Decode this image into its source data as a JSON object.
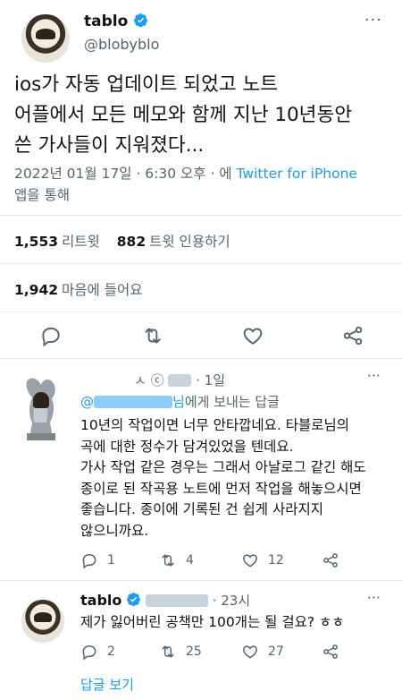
{
  "main": {
    "name": "tablo",
    "handle": "@blobyblo",
    "more": "···",
    "text_lines": [
      "ios가 자동 업데이트 되었고 노트",
      "어플에서 모든 메모와 함께 지난 10년동안",
      "쓴 가사들이 지워졌다..."
    ],
    "meta_time": "2022년 01월 17일 · 6:30 오후 · 에 ",
    "meta_source": "Twitter for iPhone",
    "meta_suffix": "앱을 통해",
    "retweets_count": "1,553",
    "retweets_label": "리트윗",
    "quotes_count": "882",
    "quotes_label": "트윗 인용하기",
    "likes_count": "1,942",
    "likes_label": "마음에 들어요"
  },
  "reply1": {
    "header_mark": "ㅅ ⓒ",
    "time": "· 1일",
    "more": "···",
    "to_prefix": "@",
    "to_mention_end": "님",
    "to_suffix": "에게 보내는 답글",
    "text_lines": [
      "10년의 작업이면 너무 안타깝네요. 타블로님의",
      "곡에 대한 정수가 담겨있었을 텐데요.",
      "가사 작업 같은 경우는 그래서 아날로그 같긴 해도",
      "종이로 된 작곡용 노트에 먼저 작업을 해놓으시면",
      "좋습니다. 종이에 기록된 건 쉽게 사라지지",
      "않으니까요."
    ],
    "replies": "1",
    "retweets": "4",
    "likes": "12"
  },
  "reply2": {
    "name": "tablo",
    "time": "· 23시",
    "more": "···",
    "text": "제가 잃어버린 공책만 100개는 될 걸요? ㅎㅎ",
    "replies": "2",
    "retweets": "25",
    "likes": "27",
    "show_replies": "답글 보기"
  },
  "colors": {
    "accent": "#1d9bf0",
    "secondary_text": "#536471",
    "divider": "#e6ecf0"
  },
  "icons": [
    "verified-badge-icon",
    "reply-icon",
    "retweet-icon",
    "like-icon",
    "share-icon",
    "more-icon"
  ]
}
